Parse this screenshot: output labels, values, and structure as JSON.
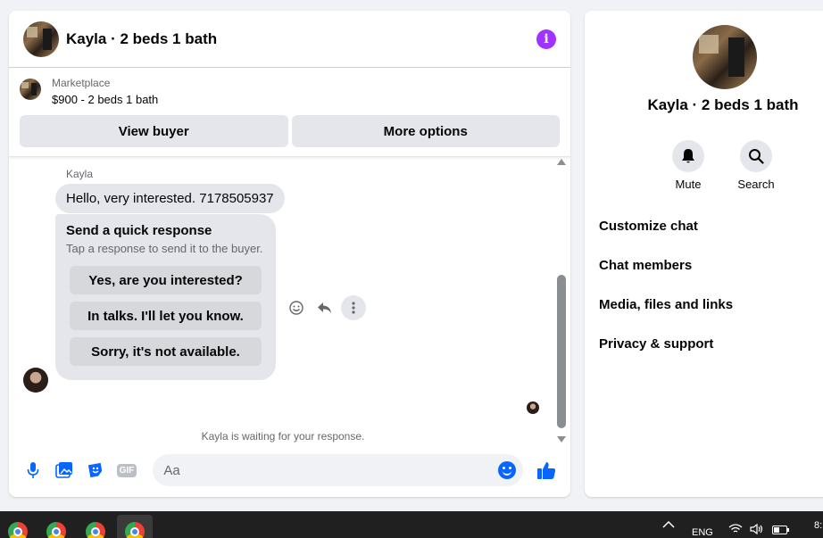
{
  "chat": {
    "title": "Kayla · 2 beds 1 bath",
    "marketplace_label": "Marketplace",
    "listing": "$900 - 2 beds 1 bath",
    "view_buyer_label": "View buyer",
    "more_options_label": "More options",
    "sender_name": "Kayla",
    "message": "Hello, very interested. 7178505937",
    "quick_response": {
      "title": "Send a quick response",
      "subtitle": "Tap a response to send it to the buyer.",
      "options": [
        "Yes, are you interested?",
        "In talks. I'll let you know.",
        "Sorry, it's not available."
      ]
    },
    "waiting_text": "Kayla is waiting for your response.",
    "composer_placeholder": "Aa"
  },
  "info_panel": {
    "title": "Kayla · 2 beds 1 bath",
    "actions": [
      {
        "label": "Mute",
        "icon": "bell-icon"
      },
      {
        "label": "Search",
        "icon": "search-icon"
      }
    ],
    "menu": [
      "Customize chat",
      "Chat members",
      "Media, files and links",
      "Privacy & support"
    ]
  },
  "taskbar": {
    "language": "ENG",
    "clock_partial": "8:"
  },
  "colors": {
    "accent": "#0866ff",
    "info": "#a033ff"
  }
}
